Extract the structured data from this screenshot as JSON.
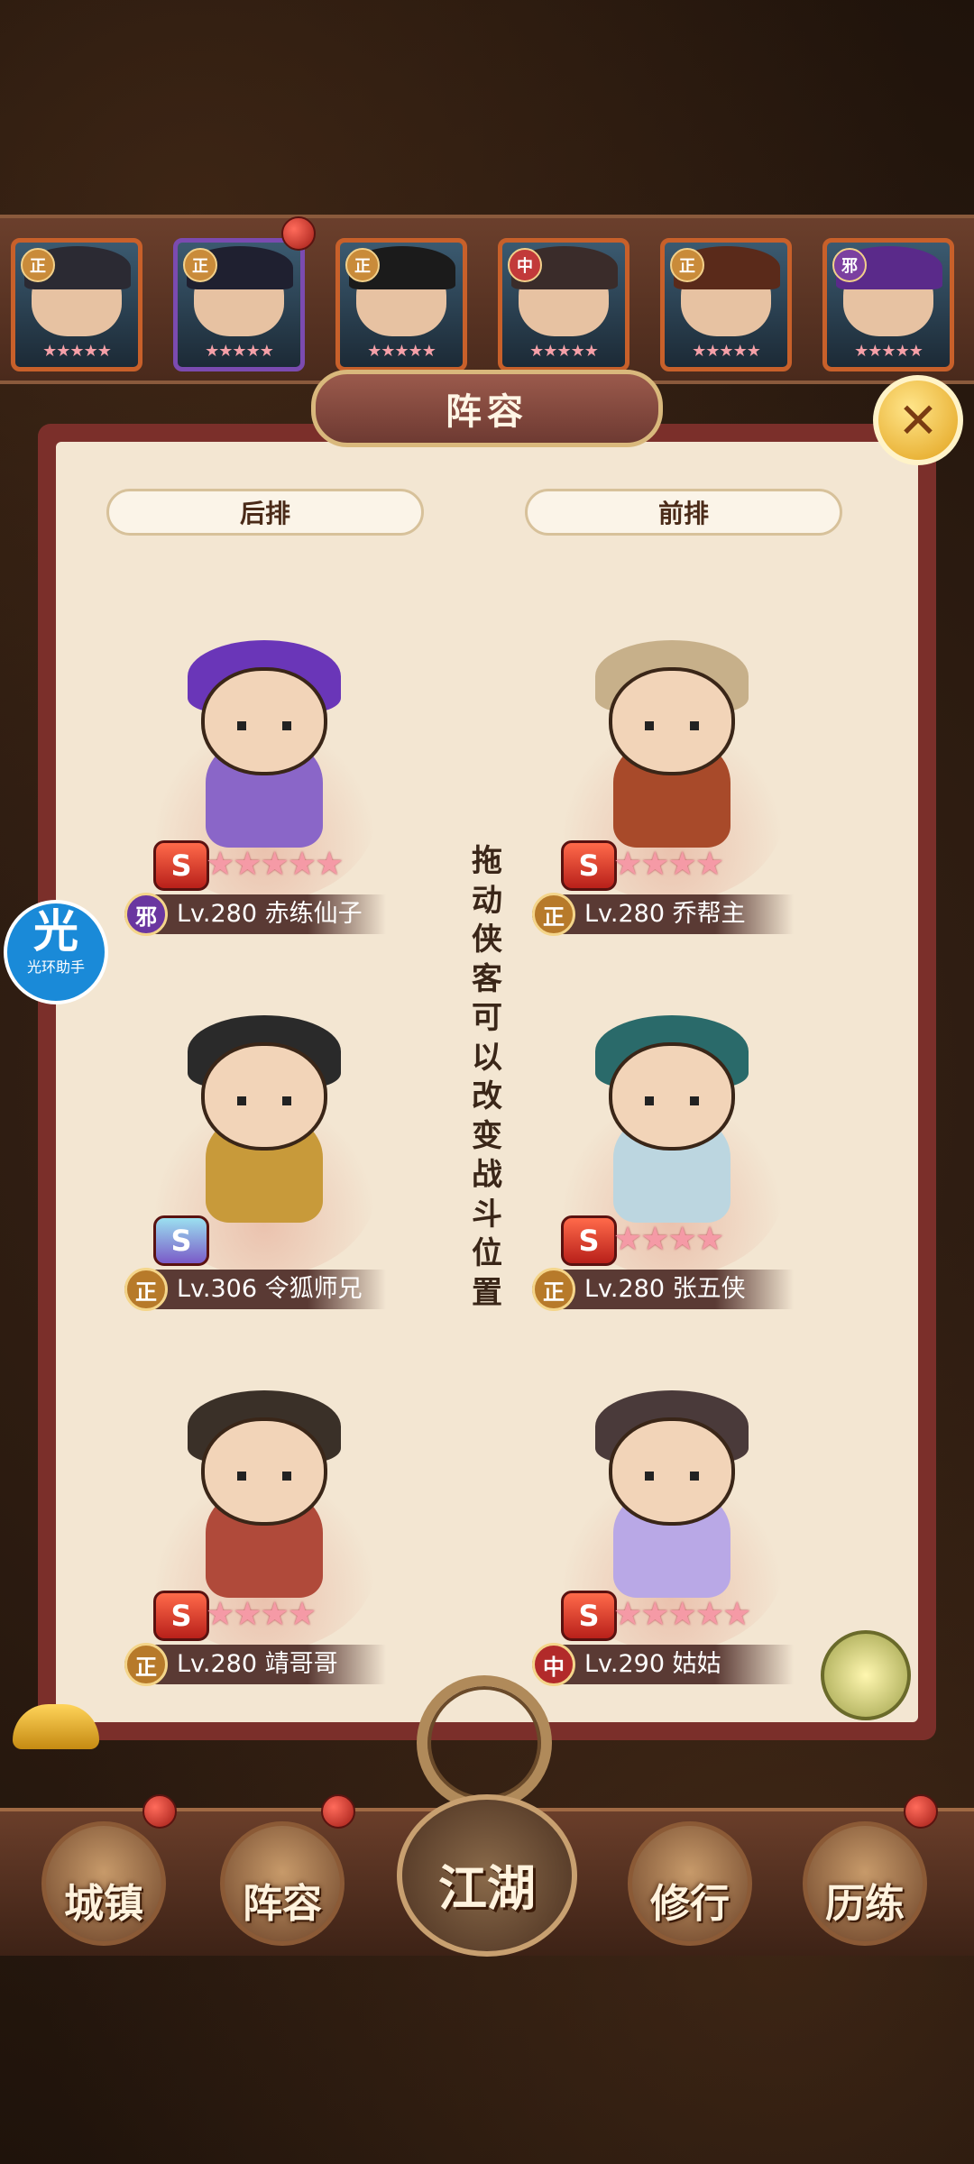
{
  "roster": {
    "cards": [
      {
        "tag": "正",
        "stars": "★★★★★",
        "hair": "#2b2a33"
      },
      {
        "tag": "正",
        "stars": "★★★★★",
        "hair": "#1f2030"
      },
      {
        "tag": "正",
        "stars": "★★★★★",
        "hair": "#1b1b1b"
      },
      {
        "tag": "中",
        "stars": "★★★★★",
        "hair": "#3a2c2a"
      },
      {
        "tag": "正",
        "stars": "★★★★★",
        "hair": "#5a2a1a"
      },
      {
        "tag": "邪",
        "stars": "★★★★★",
        "hair": "#5a2a8a"
      }
    ]
  },
  "panel": {
    "title": "阵容",
    "back_row_label": "后排",
    "front_row_label": "前排",
    "hint": "拖动侠客可以改变战斗位置"
  },
  "heroes": [
    {
      "faction": "邪",
      "name_line": "Lv.280 赤练仙子",
      "stars": "★★★★★",
      "hair": "#6a36b8",
      "body": "#8a66c8"
    },
    {
      "faction": "正",
      "name_line": "Lv.280 乔帮主",
      "stars": "★★★★",
      "hair": "#c7b08a",
      "body": "#a84a2a"
    },
    {
      "faction": "正",
      "name_line": "Lv.306 令狐师兄",
      "stars": "",
      "hair": "#2a2a2a",
      "body": "#c89a3a"
    },
    {
      "faction": "正",
      "name_line": "Lv.280 张五侠",
      "stars": "★★★★",
      "hair": "#2a6a6a",
      "body": "#bcd6e0"
    },
    {
      "faction": "正",
      "name_line": "Lv.280 靖哥哥",
      "stars": "★★★★",
      "hair": "#3a3028",
      "body": "#b04a3a"
    },
    {
      "faction": "中",
      "name_line": "Lv.290 姑姑",
      "stars": "★★★★★",
      "hair": "#4a3a3a",
      "body": "#b9a8e6"
    }
  ],
  "assistant": {
    "char": "光",
    "label": "光环助手"
  },
  "nav": {
    "town": "城镇",
    "lineup": "阵容",
    "jianghu": "江湖",
    "cultivate": "修行",
    "train": "历练"
  },
  "colors": {
    "panel_frame": "#7b2f2a",
    "panel_fill": "#f3e6d2",
    "star_pink": "#f59aa6",
    "gold": "#e2a21c"
  }
}
